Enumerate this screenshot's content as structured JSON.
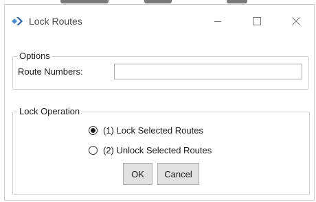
{
  "window": {
    "title": "Lock Routes",
    "icons": {
      "app": "diamond-arrow-icon",
      "minimize": "minimize-icon",
      "maximize": "maximize-icon",
      "close": "close-icon"
    },
    "accent_color": "#3b7dd8"
  },
  "options": {
    "legend": "Options",
    "route_numbers_label": "Route Numbers:",
    "route_numbers_value": ""
  },
  "lock_operation": {
    "legend": "Lock Operation",
    "choices": [
      {
        "label": "(1) Lock Selected Routes",
        "selected": true
      },
      {
        "label": "(2) Unlock Selected Routes",
        "selected": false
      }
    ]
  },
  "buttons": {
    "ok": "OK",
    "cancel": "Cancel"
  }
}
